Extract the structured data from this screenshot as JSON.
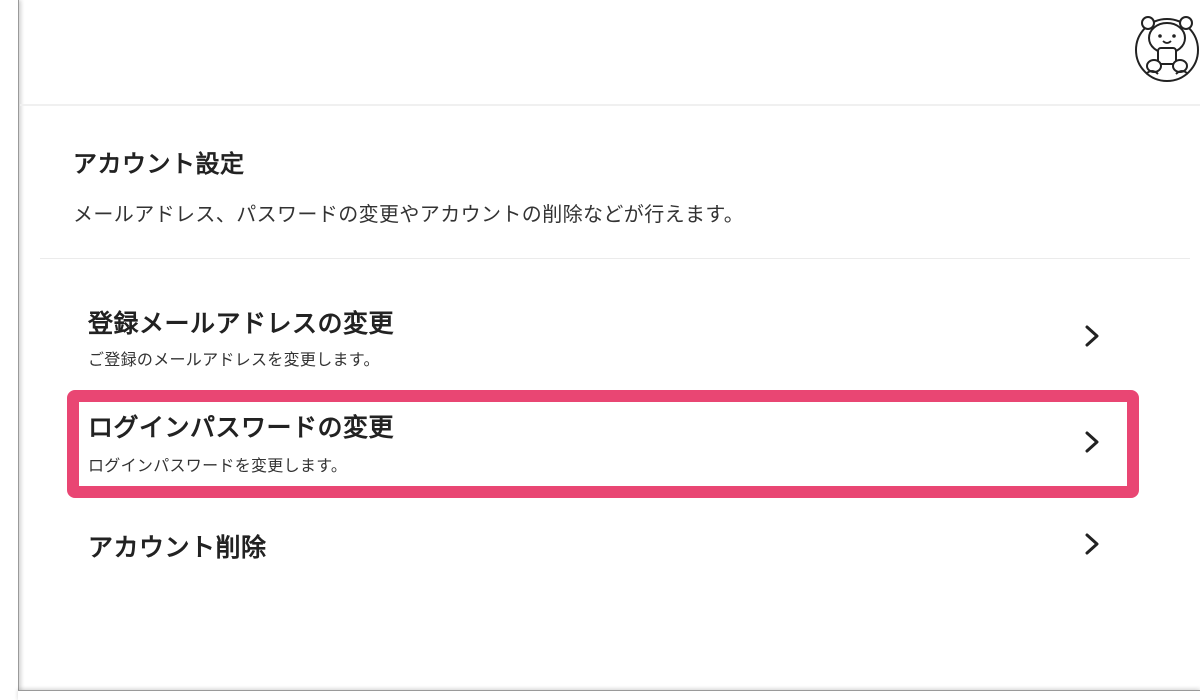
{
  "header": {
    "avatar_alt": "bear-avatar"
  },
  "account_settings": {
    "title": "アカウント設定",
    "description": "メールアドレス、パスワードの変更やアカウントの削除などが行えます。"
  },
  "menu": {
    "items": [
      {
        "title": "登録メールアドレスの変更",
        "subtitle": "ご登録のメールアドレスを変更します。",
        "icon": "chevron-right-icon"
      },
      {
        "title": "ログインパスワードの変更",
        "subtitle": "ログインパスワードを変更します。",
        "icon": "chevron-right-icon",
        "highlighted": true
      },
      {
        "title": "アカウント削除",
        "icon": "chevron-right-icon"
      }
    ]
  },
  "colors": {
    "highlight": "#e94673",
    "text": "#222222"
  }
}
